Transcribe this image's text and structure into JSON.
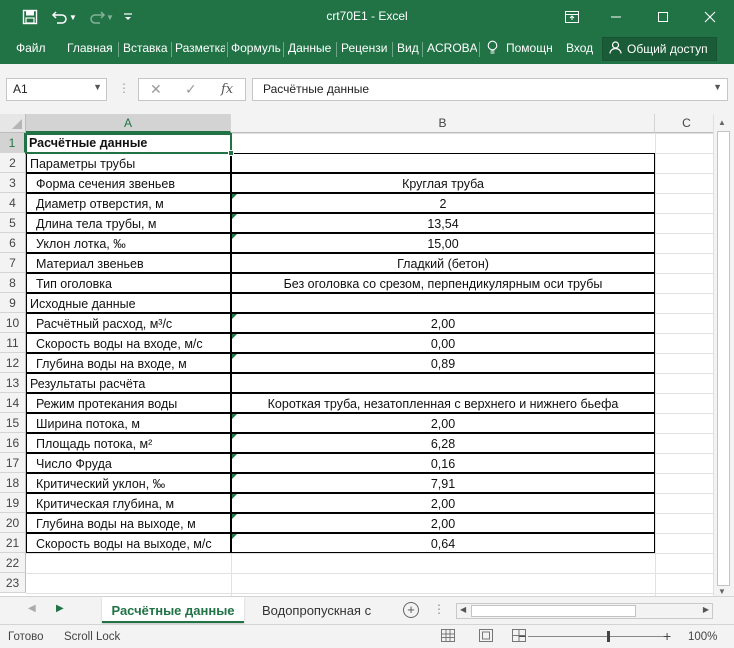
{
  "window": {
    "title": "crt70E1  -  Excel",
    "save_icon": "floppy-disk-icon",
    "undo_icon": "undo-arrow-icon",
    "redo_icon": "redo-arrow-icon",
    "qat_icon": "customize-toolbar-icon"
  },
  "ribbon": {
    "tabs": [
      "Файл",
      "Главная",
      "Вставка",
      "Разметка",
      "Формулы",
      "Данные",
      "Рецензи",
      "Вид",
      "ACROBA"
    ],
    "tell_me": "Помощн",
    "signin": "Вход",
    "share": "Общий доступ"
  },
  "formula_bar": {
    "name_box": "A1",
    "fx_label": "fx",
    "content": "Расчётные данные"
  },
  "columns": [
    "A",
    "B",
    "C"
  ],
  "rows": [
    {
      "num": "1",
      "a": "Расчётные данные",
      "b": "",
      "bold": true,
      "bordered": false,
      "indent": false,
      "tri": false
    },
    {
      "num": "2",
      "a": "Параметры трубы",
      "b": "",
      "bold": false,
      "bordered": true,
      "indent": false,
      "tri": false
    },
    {
      "num": "3",
      "a": "Форма сечения звеньев",
      "b": "Круглая труба",
      "bold": false,
      "bordered": true,
      "indent": true,
      "tri": false
    },
    {
      "num": "4",
      "a": "Диаметр отверстия, м",
      "b": "2",
      "bold": false,
      "bordered": true,
      "indent": true,
      "tri": true
    },
    {
      "num": "5",
      "a": "Длина тела трубы, м",
      "b": "13,54",
      "bold": false,
      "bordered": true,
      "indent": true,
      "tri": true
    },
    {
      "num": "6",
      "a": "Уклон лотка, ‰",
      "b": "15,00",
      "bold": false,
      "bordered": true,
      "indent": true,
      "tri": true
    },
    {
      "num": "7",
      "a": "Материал звеньев",
      "b": "Гладкий (бетон)",
      "bold": false,
      "bordered": true,
      "indent": true,
      "tri": false
    },
    {
      "num": "8",
      "a": "Тип оголовка",
      "b": "Без оголовка со срезом, перпендикулярным оси трубы",
      "bold": false,
      "bordered": true,
      "indent": true,
      "tri": false
    },
    {
      "num": "9",
      "a": "Исходные данные",
      "b": "",
      "bold": false,
      "bordered": true,
      "indent": false,
      "tri": false
    },
    {
      "num": "10",
      "a": "Расчётный расход, м³/с",
      "b": "2,00",
      "bold": false,
      "bordered": true,
      "indent": true,
      "tri": true
    },
    {
      "num": "11",
      "a": "Скорость воды на входе, м/с",
      "b": "0,00",
      "bold": false,
      "bordered": true,
      "indent": true,
      "tri": true
    },
    {
      "num": "12",
      "a": "Глубина воды на входе, м",
      "b": "0,89",
      "bold": false,
      "bordered": true,
      "indent": true,
      "tri": true
    },
    {
      "num": "13",
      "a": "Результаты расчёта",
      "b": "",
      "bold": false,
      "bordered": true,
      "indent": false,
      "tri": false
    },
    {
      "num": "14",
      "a": "Режим протекания воды",
      "b": "Короткая труба, незатопленная с верхнего и нижнего бьефа",
      "bold": false,
      "bordered": true,
      "indent": true,
      "tri": false
    },
    {
      "num": "15",
      "a": "Ширина потока, м",
      "b": "2,00",
      "bold": false,
      "bordered": true,
      "indent": true,
      "tri": true
    },
    {
      "num": "16",
      "a": "Площадь потока, м²",
      "b": "6,28",
      "bold": false,
      "bordered": true,
      "indent": true,
      "tri": true
    },
    {
      "num": "17",
      "a": "Число Фруда",
      "b": "0,16",
      "bold": false,
      "bordered": true,
      "indent": true,
      "tri": true
    },
    {
      "num": "18",
      "a": "Критический уклон, ‰",
      "b": "7,91",
      "bold": false,
      "bordered": true,
      "indent": true,
      "tri": true
    },
    {
      "num": "19",
      "a": "Критическая глубина, м",
      "b": "2,00",
      "bold": false,
      "bordered": true,
      "indent": true,
      "tri": true
    },
    {
      "num": "20",
      "a": "Глубина воды на выходе, м",
      "b": "2,00",
      "bold": false,
      "bordered": true,
      "indent": true,
      "tri": true
    },
    {
      "num": "21",
      "a": "Скорость воды на выходе, м/с",
      "b": "0,64",
      "bold": false,
      "bordered": true,
      "indent": true,
      "tri": true
    },
    {
      "num": "22",
      "a": "",
      "b": "",
      "bold": false,
      "bordered": false,
      "indent": false,
      "tri": false
    },
    {
      "num": "23",
      "a": "",
      "b": "",
      "bold": false,
      "bordered": false,
      "indent": false,
      "tri": false
    }
  ],
  "sheets": {
    "active": "Расчётные данные",
    "other": "Водопропускная с"
  },
  "status": {
    "ready": "Готово",
    "scroll_lock": "Scroll Lock",
    "zoom": "100%"
  },
  "colors": {
    "excel_green": "#217346",
    "error_indicator": "#1e7b47"
  }
}
